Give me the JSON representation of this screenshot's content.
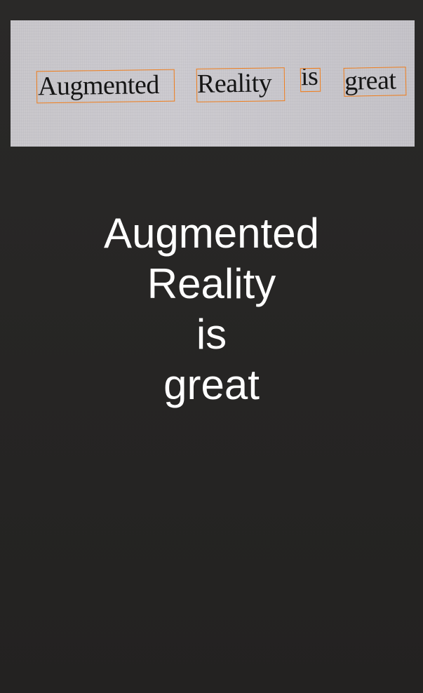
{
  "camera_preview": {
    "detected_words": [
      "Augmented",
      "Reality",
      "is",
      "great"
    ]
  },
  "result": {
    "lines": [
      "Augmented",
      "Reality",
      "is",
      "great"
    ]
  },
  "colors": {
    "background": "#272625",
    "preview_paper": "#cac8cc",
    "detection_box": "#ef7d1c",
    "result_text": "#ffffff"
  }
}
